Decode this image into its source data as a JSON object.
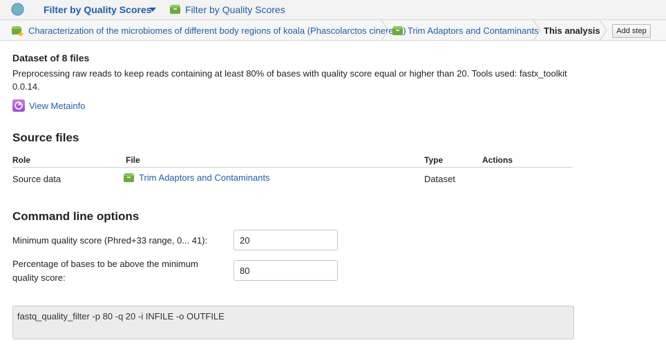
{
  "topbar": {
    "analysis_title": "Filter by Quality Scores",
    "link_label": "Filter by Quality Scores"
  },
  "breadcrumb": {
    "project": "Characterization of the microbiomes of different body regions of koala (Phascolarctos cinereus)",
    "parent_step": "Trim Adaptors and Contaminants",
    "current": "This analysis",
    "add_step": "Add step"
  },
  "dataset": {
    "title": "Dataset of 8 files",
    "description": "Preprocessing raw reads to keep reads containing at least 80% of bases with quality score equal or higher than 20. Tools used: fastx_toolkit 0.0.14.",
    "metainfo_link": "View Metainfo"
  },
  "source_files": {
    "title": "Source files",
    "headers": {
      "role": "Role",
      "file": "File",
      "type": "Type",
      "actions": "Actions"
    },
    "rows": [
      {
        "role": "Source data",
        "file": "Trim Adaptors and Contaminants",
        "type": "Dataset",
        "actions": ""
      }
    ]
  },
  "command_options": {
    "title": "Command line options",
    "min_quality_label": "Minimum quality score (Phred+33 range, 0... 41):",
    "min_quality_value": "20",
    "percentage_label_line1": "Percentage of bases to be above the minimum",
    "percentage_label_line2": "quality score:",
    "percentage_value": "80"
  },
  "command_line": "fastq_quality_filter -p 80 -q 20 -i INFILE -o OUTFILE",
  "colors": {
    "link": "#1f5fa8",
    "folder_green": "#6aab3c",
    "metainfo_purple": "#b066dd"
  }
}
